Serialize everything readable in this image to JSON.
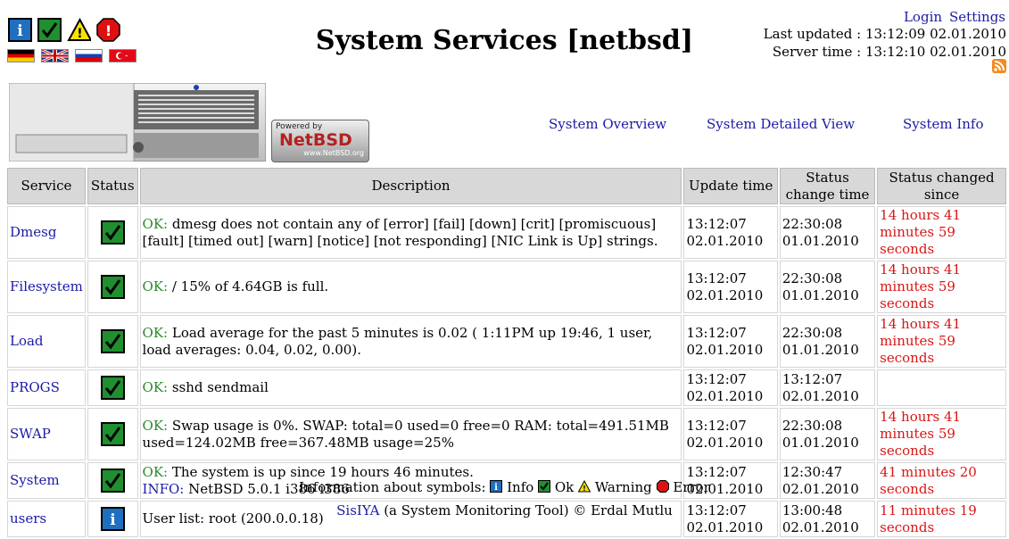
{
  "header": {
    "title": "System Services [netbsd]",
    "login": "Login",
    "settings": "Settings",
    "last_updated": "Last updated : 13:12:09 02.01.2010",
    "server_time": "Server time : 13:12:10 02.01.2010",
    "status_icons": [
      "info-icon",
      "ok-icon",
      "warning-icon",
      "error-icon"
    ],
    "flags": [
      "flag-de-icon",
      "flag-gb-icon",
      "flag-ru-icon",
      "flag-tr-icon"
    ],
    "rss_icon": "rss-icon"
  },
  "banner": {
    "powered_by": "Powered by",
    "netbsd": "NetBSD",
    "netbsd_url": "www.NetBSD.org"
  },
  "nav": [
    "System Overview",
    "System Detailed View",
    "System Info"
  ],
  "table": {
    "headers": [
      "Service",
      "Status",
      "Description",
      "Update time",
      "Status change time",
      "Status changed since"
    ],
    "rows": [
      {
        "service": "Dmesg",
        "status": "ok",
        "prefix": "OK:",
        "desc": " dmesg does not contain any of [error] [fail] [down] [crit] [promiscuous] [fault] [timed out] [warn] [notice] [not responding] [NIC Link is Up] strings.",
        "info_prefix": "",
        "info": "",
        "update": "13:12:07 02.01.2010",
        "change": "22:30:08 01.01.2010",
        "since": "14 hours 41 minutes 59 seconds"
      },
      {
        "service": "Filesystem",
        "status": "ok",
        "prefix": "OK:",
        "desc": " / 15% of 4.64GB is full.",
        "info_prefix": "",
        "info": "",
        "update": "13:12:07 02.01.2010",
        "change": "22:30:08 01.01.2010",
        "since": "14 hours 41 minutes 59 seconds"
      },
      {
        "service": "Load",
        "status": "ok",
        "prefix": "OK:",
        "desc": " Load average for the past 5 minutes is 0.02 ( 1:11PM up 19:46, 1 user, load averages: 0.04, 0.02, 0.00).",
        "info_prefix": "",
        "info": "",
        "update": "13:12:07 02.01.2010",
        "change": "22:30:08 01.01.2010",
        "since": "14 hours 41 minutes 59 seconds"
      },
      {
        "service": "PROGS",
        "status": "ok",
        "prefix": "OK:",
        "desc": " sshd sendmail",
        "info_prefix": "",
        "info": "",
        "update": "13:12:07 02.01.2010",
        "change": "13:12:07 02.01.2010",
        "since": ""
      },
      {
        "service": "SWAP",
        "status": "ok",
        "prefix": "OK:",
        "desc": " Swap usage is 0%. SWAP: total=0 used=0 free=0 RAM: total=491.51MB used=124.02MB free=367.48MB usage=25%",
        "info_prefix": "",
        "info": "",
        "update": "13:12:07 02.01.2010",
        "change": "22:30:08 01.01.2010",
        "since": "14 hours 41 minutes 59 seconds"
      },
      {
        "service": "System",
        "status": "ok",
        "prefix": "OK:",
        "desc": " The system is up since 19 hours 46 minutes.",
        "info_prefix": "INFO:",
        "info": " NetBSD 5.0.1 i386 i386",
        "update": "13:12:07 02.01.2010",
        "change": "12:30:47 02.01.2010",
        "since": "41 minutes 20 seconds"
      },
      {
        "service": "users",
        "status": "info",
        "prefix": "",
        "desc": "User list: root (200.0.0.18)",
        "info_prefix": "",
        "info": "",
        "update": "13:12:07 02.01.2010",
        "change": "13:00:48 02.01.2010",
        "since": "11 minutes 19 seconds"
      }
    ]
  },
  "legend": {
    "intro": "Information about symbols:",
    "info": "Info",
    "ok": "Ok",
    "warning": "Warning",
    "error": "Error"
  },
  "footer": {
    "link": "SisIYA",
    "text": " (a System Monitoring Tool) © Erdal Mutlu"
  },
  "colors": {
    "link": "#1a1aa6",
    "ok": "#2a8a2a",
    "since": "#d81616",
    "ok_icon_bg": "#1f8f2f",
    "info_icon_bg": "#1e6fbf"
  }
}
